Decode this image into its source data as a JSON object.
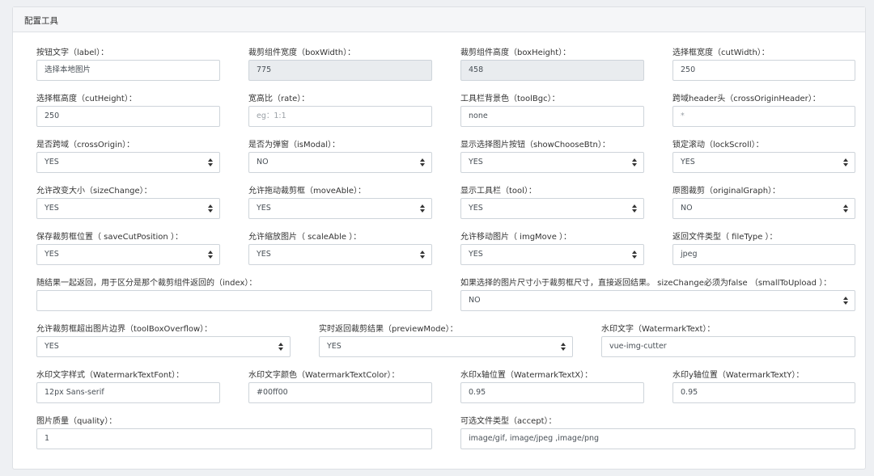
{
  "panel": {
    "title": "配置工具"
  },
  "fields": {
    "label": {
      "label": "按钮文字（label）：",
      "value": "选择本地图片"
    },
    "boxWidth": {
      "label": "裁剪组件宽度（boxWidth）：",
      "value": "775"
    },
    "boxHeight": {
      "label": "裁剪组件高度（boxHeight）：",
      "value": "458"
    },
    "cutWidth": {
      "label": "选择框宽度（cutWidth）：",
      "value": "250"
    },
    "cutHeight": {
      "label": "选择框高度（cutHeight）：",
      "value": "250"
    },
    "rate": {
      "label": "宽高比（rate）：",
      "placeholder": "eg：1:1"
    },
    "toolBgc": {
      "label": "工具栏背景色（toolBgc）：",
      "value": "none"
    },
    "crossOriginHeader": {
      "label": "跨域header头（crossOriginHeader）：",
      "placeholder": "*"
    },
    "crossOrigin": {
      "label": "是否跨域（crossOrigin）：",
      "value": "YES"
    },
    "isModal": {
      "label": "是否为弹窗（isModal）：",
      "value": "NO"
    },
    "showChooseBtn": {
      "label": "显示选择图片按钮（showChooseBtn）：",
      "value": "YES"
    },
    "lockScroll": {
      "label": "锁定滚动（lockScroll）：",
      "value": "YES"
    },
    "sizeChange": {
      "label": "允许改变大小（sizeChange）：",
      "value": "YES"
    },
    "moveAble": {
      "label": "允许拖动裁剪框（moveAble）：",
      "value": "YES"
    },
    "tool": {
      "label": "显示工具栏（tool）：",
      "value": "YES"
    },
    "originalGraph": {
      "label": "原图裁剪（originalGraph）：",
      "value": "NO"
    },
    "saveCutPosition": {
      "label": "保存裁剪框位置（ saveCutPosition ）：",
      "value": "YES"
    },
    "scaleAble": {
      "label": "允许缩放图片（ scaleAble ）：",
      "value": "YES"
    },
    "imgMove": {
      "label": "允许移动图片（ imgMove ）：",
      "value": "YES"
    },
    "fileType": {
      "label": "返回文件类型（ fileType ）：",
      "value": "jpeg"
    },
    "index": {
      "label": "随结果一起返回，用于区分是那个裁剪组件返回的（index）：",
      "value": ""
    },
    "smallToUpload": {
      "label": "如果选择的图片尺寸小于裁剪框尺寸，直接返回结果。 sizeChange必须为false （smallToUpload ）：",
      "value": "NO"
    },
    "toolBoxOverflow": {
      "label": "允许裁剪框超出图片边界（toolBoxOverflow）：",
      "value": "YES"
    },
    "previewMode": {
      "label": "实时返回裁剪结果（previewMode）：",
      "value": "YES"
    },
    "WatermarkText": {
      "label": "水印文字（WatermarkText）：",
      "value": "vue-img-cutter"
    },
    "WatermarkTextFont": {
      "label": "水印文字样式（WatermarkTextFont）：",
      "value": "12px Sans-serif"
    },
    "WatermarkTextColor": {
      "label": "水印文字颜色（WatermarkTextColor）：",
      "value": "#00ff00"
    },
    "WatermarkTextX": {
      "label": "水印x轴位置（WatermarkTextX）：",
      "value": "0.95"
    },
    "WatermarkTextY": {
      "label": "水印y轴位置（WatermarkTextY）：",
      "value": "0.95"
    },
    "quality": {
      "label": "图片质量（quality）：",
      "value": "1"
    },
    "accept": {
      "label": "可选文件类型（accept）：",
      "value": "image/gif, image/jpeg ,image/png"
    }
  }
}
